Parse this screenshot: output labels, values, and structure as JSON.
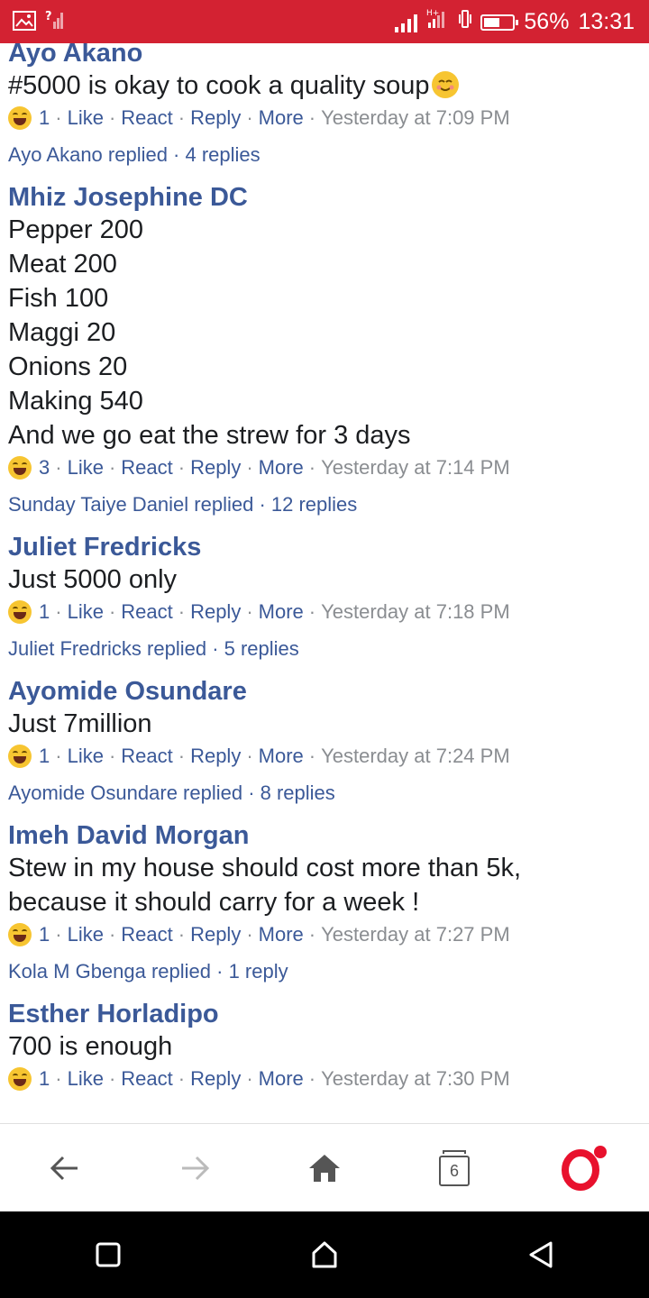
{
  "status_bar": {
    "battery": "56%",
    "battery_level": 0.56,
    "time": "13:31",
    "bg_color": "#d32232",
    "icons": [
      "image-icon",
      "no-sim-signal-icon",
      "signal-icon",
      "signal-hplus-icon",
      "vibrate-icon",
      "battery-icon"
    ]
  },
  "comments": [
    {
      "author": "Ayo Akano",
      "text": "#5000 is okay to cook a quality soup",
      "trailing_emoji": "smiling-face-icon",
      "reactions": "1",
      "actions": {
        "like": "Like",
        "react": "React",
        "reply": "Reply",
        "more": "More"
      },
      "time": "Yesterday at 7:09 PM",
      "replies_summary": "Ayo Akano replied · 4 replies"
    },
    {
      "author": "Mhiz Josephine DC",
      "text": "Pepper 200\nMeat 200\nFish 100\nMaggi 20\nOnions 20\nMaking 540\nAnd we go eat the strew for 3 days",
      "reactions": "3",
      "actions": {
        "like": "Like",
        "react": "React",
        "reply": "Reply",
        "more": "More"
      },
      "time": "Yesterday at 7:14 PM",
      "replies_summary": "Sunday Taiye Daniel replied · 12 replies"
    },
    {
      "author": "Juliet Fredricks",
      "text": "Just 5000 only",
      "reactions": "1",
      "actions": {
        "like": "Like",
        "react": "React",
        "reply": "Reply",
        "more": "More"
      },
      "time": "Yesterday at 7:18 PM",
      "replies_summary": "Juliet Fredricks replied · 5 replies"
    },
    {
      "author": "Ayomide Osundare",
      "text": "Just 7million",
      "reactions": "1",
      "actions": {
        "like": "Like",
        "react": "React",
        "reply": "Reply",
        "more": "More"
      },
      "time": "Yesterday at 7:24 PM",
      "replies_summary": "Ayomide Osundare replied · 8 replies"
    },
    {
      "author": "Imeh David Morgan",
      "text": "Stew in my house should cost more than 5k, because it should carry for a week !",
      "reactions": "1",
      "actions": {
        "like": "Like",
        "react": "React",
        "reply": "Reply",
        "more": "More"
      },
      "time": "Yesterday at 7:27 PM",
      "replies_summary": "Kola M Gbenga replied · 1 reply"
    },
    {
      "author": "Esther Horladipo",
      "text": "700 is enough",
      "reactions": "1",
      "actions": {
        "like": "Like",
        "react": "React",
        "reply": "Reply",
        "more": "More"
      },
      "time": "Yesterday at 7:30 PM",
      "replies_summary": ""
    }
  ],
  "browser_nav": {
    "tabs_count": "6",
    "icons": [
      "back-arrow-icon",
      "forward-arrow-icon",
      "home-icon",
      "tabs-icon",
      "opera-logo-icon"
    ],
    "accent_color": "#e8112d"
  },
  "system_nav": {
    "icons": [
      "recents-square-icon",
      "home-circle-icon",
      "back-triangle-icon"
    ]
  }
}
